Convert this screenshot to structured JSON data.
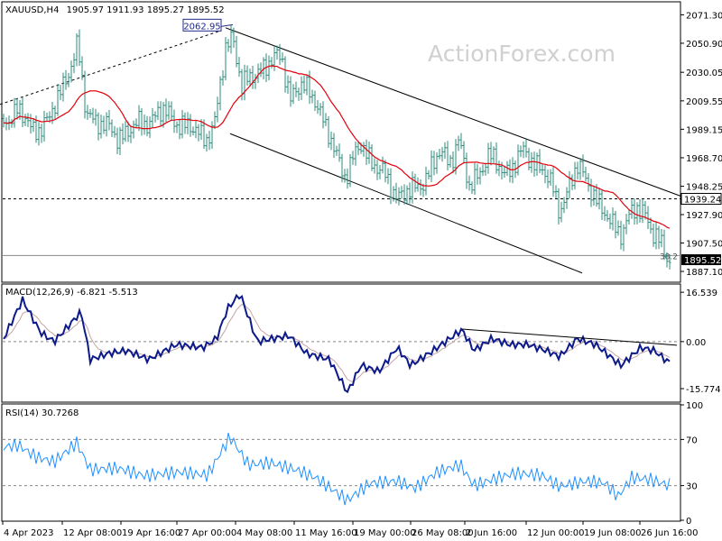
{
  "chart_data": [
    {
      "type": "candlestick",
      "title": "XAUUSD,H4",
      "ohlc_header": "1905.97 1911.93 1895.27 1895.52",
      "watermark": "ActionForex.com",
      "ylim": [
        1880.0,
        2080.0
      ],
      "y_ticks": [
        "2071.30",
        "2050.90",
        "2030.05",
        "2009.55",
        "1989.15",
        "1968.70",
        "1948.25",
        "1927.90",
        "1907.50",
        "1887.10"
      ],
      "y_tick_values": [
        2071.3,
        2050.9,
        2030.05,
        2009.55,
        1989.15,
        1968.7,
        1948.25,
        1927.9,
        1907.5,
        1887.1
      ],
      "last_price_label": "1895.52",
      "last_price": 1895.52,
      "level_label": "1939.24",
      "level": 1939.24,
      "peak_label": "2062.95",
      "peak": 2062.95,
      "fib_label": "38.2",
      "fib_level": 1898.5,
      "moving_average": {
        "color": "#e3000b"
      },
      "trendlines": [
        {
          "name": "channel-upper",
          "from": [
            250,
            2062
          ],
          "to": [
            755,
            1941
          ]
        },
        {
          "name": "channel-lower",
          "from": [
            255,
            1986
          ],
          "to": [
            645,
            1886
          ]
        },
        {
          "name": "prior-support",
          "from": [
            0,
            2007
          ],
          "to": [
            245,
            2060
          ],
          "style": "dotted"
        }
      ],
      "colors": {
        "bar": "#2e8b7e",
        "ma": "#e3000b",
        "levels": "#000000"
      }
    },
    {
      "type": "line",
      "title": "MACD(12,26,9) -6.821 -5.513",
      "ylim": [
        -20.0,
        19.0
      ],
      "y_ticks": [
        "16.539",
        "0.00",
        "-15.774"
      ],
      "y_tick_values": [
        16.539,
        0.0,
        -15.774
      ],
      "series": [
        {
          "name": "MACD",
          "color": "#0c1a8a"
        },
        {
          "name": "Signal",
          "color": "#c4a4a4"
        }
      ],
      "trendline": {
        "from": [
          512,
          4.2
        ],
        "to": [
          750,
          -1.2
        ]
      }
    },
    {
      "type": "line",
      "title": "RSI(14) 30.7268",
      "ylim": [
        0,
        100
      ],
      "y_ticks": [
        "100",
        "70",
        "30",
        "0"
      ],
      "y_tick_values": [
        100,
        70,
        30,
        0
      ],
      "levels": [
        70,
        30
      ],
      "series": [
        {
          "name": "RSI(14)",
          "color": "#1e90ff"
        }
      ]
    }
  ],
  "x_axis": {
    "labels": [
      "4 Apr 2023",
      "12 Apr 08:00",
      "19 Apr 16:00",
      "27 Apr 00:00",
      "4 May 08:00",
      "11 May 16:00",
      "19 May 00:00",
      "26 May 08:00",
      "2 Jun 16:00",
      "12 Jun 00:00",
      "19 Jun 08:00",
      "26 Jun 16:00"
    ],
    "positions": [
      0,
      66,
      131,
      193,
      258,
      323,
      388,
      452,
      512,
      580,
      643,
      706
    ]
  }
}
